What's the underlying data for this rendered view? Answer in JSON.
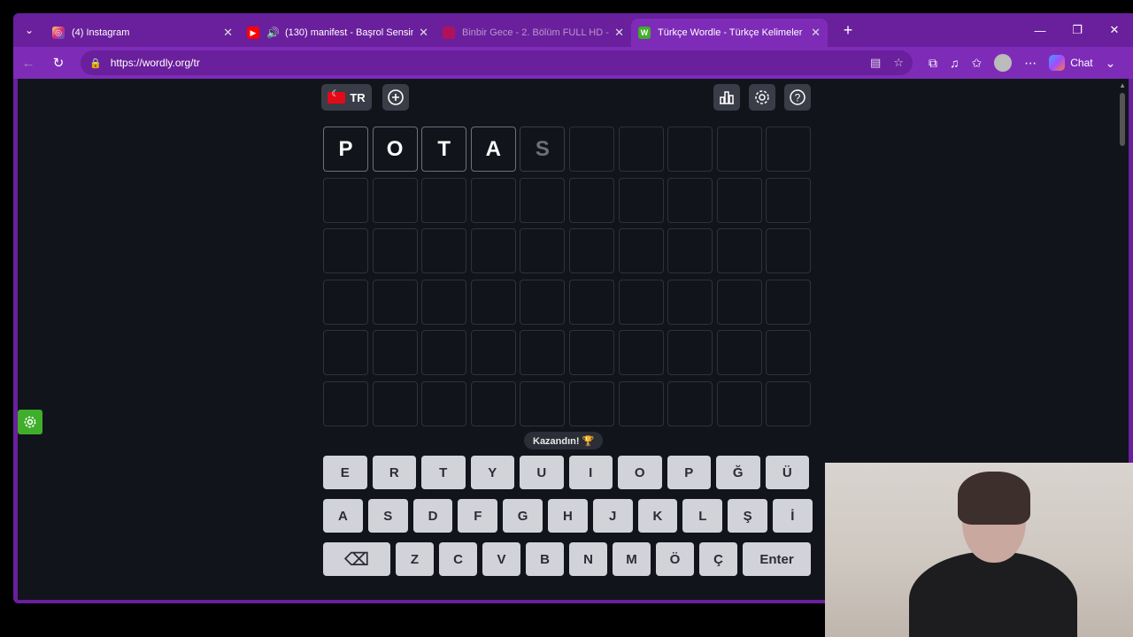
{
  "browser": {
    "tabs": [
      {
        "title": "(4) Instagram",
        "favicon": "instagram-icon",
        "active": false,
        "color": "#d6249f"
      },
      {
        "title": "(130) manifest - Başrol Sensin",
        "favicon": "youtube-icon",
        "active": false,
        "color": "#ff0000"
      },
      {
        "title": "Binbir Gece - 2. Bölüm FULL HD - ",
        "favicon": "video-icon",
        "active": false,
        "color": "#b0125a"
      },
      {
        "title": "Türkçe Wordle - Türkçe Kelimeler",
        "favicon": "wordly-icon",
        "active": true,
        "color": "#3fae2a"
      }
    ],
    "url": "https://wordly.org/tr",
    "chat_label": "Chat"
  },
  "game": {
    "lang_label": "TR",
    "grid": [
      [
        "P",
        "O",
        "T",
        "A",
        "S",
        "",
        "",
        "",
        "",
        ""
      ],
      [
        "",
        "",
        "",
        "",
        "",
        "",
        "",
        "",
        "",
        ""
      ],
      [
        "",
        "",
        "",
        "",
        "",
        "",
        "",
        "",
        "",
        ""
      ],
      [
        "",
        "",
        "",
        "",
        "",
        "",
        "",
        "",
        "",
        ""
      ],
      [
        "",
        "",
        "",
        "",
        "",
        "",
        "",
        "",
        "",
        ""
      ],
      [
        "",
        "",
        "",
        "",
        "",
        "",
        "",
        "",
        "",
        ""
      ]
    ],
    "win_message": "Kazandın! 🏆",
    "keyboard": [
      [
        "E",
        "R",
        "T",
        "Y",
        "U",
        "I",
        "O",
        "P",
        "Ğ",
        "Ü"
      ],
      [
        "A",
        "S",
        "D",
        "F",
        "G",
        "H",
        "J",
        "K",
        "L",
        "Ş",
        "İ"
      ],
      [
        "⌫",
        "Z",
        "C",
        "V",
        "B",
        "N",
        "M",
        "Ö",
        "Ç",
        "Enter"
      ]
    ]
  },
  "colors": {
    "browser_frame": "#6a1f9c",
    "active_tab": "#7e2cb8",
    "page_bg": "#12141c",
    "key_bg": "#d2d3d8",
    "settings_green": "#3fae2a"
  }
}
